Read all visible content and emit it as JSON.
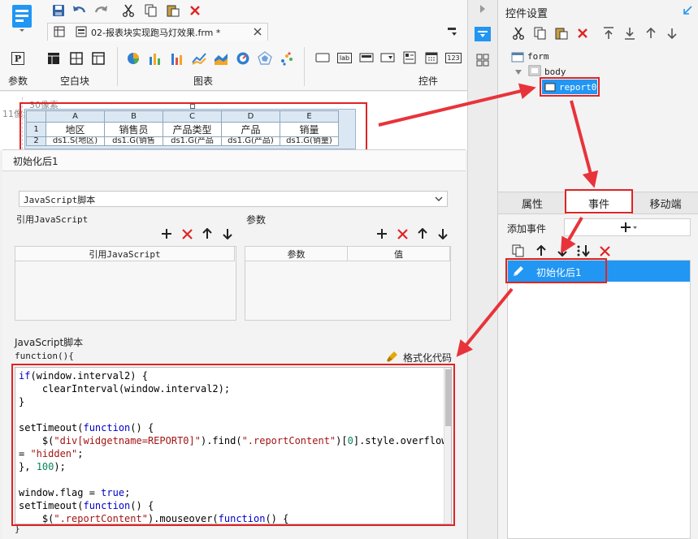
{
  "toolbar": {
    "tab_title": "02-报表块实现跑马灯效果.frm *",
    "groups": [
      "参数",
      "空白块",
      "图表",
      "控件"
    ],
    "param_letter": "P",
    "lab_text": "lab",
    "num_text": "123"
  },
  "canvas": {
    "ruler_top": "30像素",
    "ruler_left": "11像素",
    "columns": [
      "A",
      "B",
      "C",
      "D",
      "E"
    ],
    "rows": [
      "1",
      "2"
    ],
    "headers": [
      "地区",
      "销售员",
      "产品类型",
      "产品",
      "销量"
    ],
    "cells": [
      "ds1.S(地区)",
      "ds1.G(销售",
      "ds1.G(产品",
      "ds1.G(产品)",
      "ds1.G(销量)"
    ]
  },
  "editor": {
    "title": "初始化后1",
    "script_type": "JavaScript脚本",
    "ref_js_label": "引用JavaScript",
    "params_label": "参数",
    "ref_js_col": "引用JavaScript",
    "param_col": "参数",
    "value_col": "值",
    "js_section_label": "JavaScript脚本",
    "func_header": "function(){",
    "format_label": "格式化代码",
    "func_footer": "}"
  },
  "right": {
    "title": "控件设置",
    "tree": [
      "form",
      "body",
      "report0"
    ],
    "tabs": [
      "属性",
      "事件",
      "移动端"
    ],
    "add_event_label": "添加事件",
    "event_item": "初始化后1"
  },
  "colors": {
    "accent": "#2196f3",
    "highlight": "#e02424"
  }
}
